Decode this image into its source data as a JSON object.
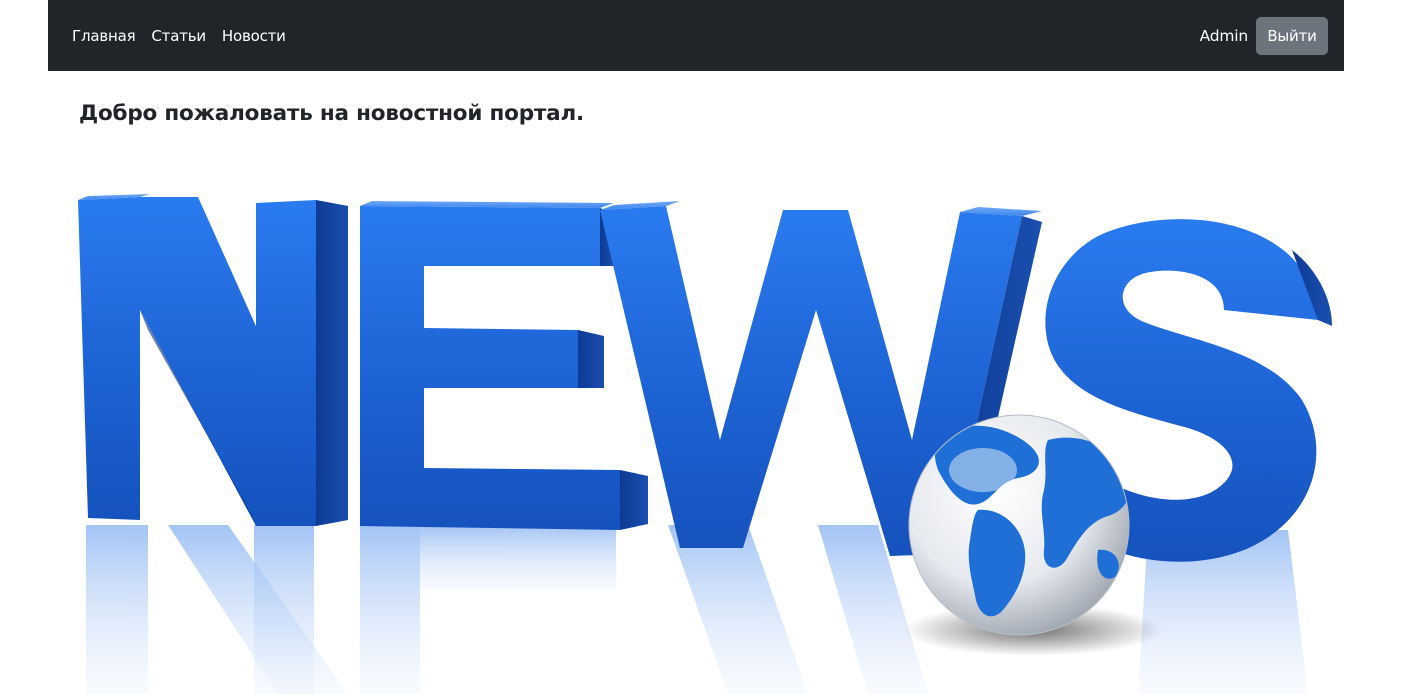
{
  "navbar": {
    "links": [
      {
        "label": "Главная"
      },
      {
        "label": "Статьи"
      },
      {
        "label": "Новости"
      }
    ],
    "username": "Admin",
    "logout_label": "Выйти"
  },
  "main": {
    "welcome_text": "Добро пожаловать на новостной портал.",
    "hero_image": {
      "subject": "NEWS",
      "icon": "globe-icon",
      "brand_blue": "#1e63d6"
    }
  }
}
